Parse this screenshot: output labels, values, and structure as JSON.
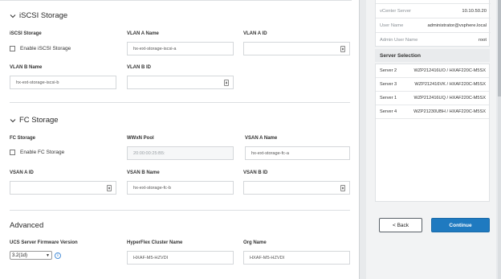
{
  "iscsi": {
    "title": "iSCSI Storage",
    "iscsi_storage_label": "iSCSI Storage",
    "enable_label": "Enable iSCSI Storage",
    "vlan_a_name_label": "VLAN A Name",
    "vlan_a_name_value": "hx-ext-storage-iscsi-a",
    "vlan_a_id_label": "VLAN A ID",
    "vlan_a_id_value": "",
    "vlan_b_name_label": "VLAN B Name",
    "vlan_b_name_value": "hx-ext-storage-iscsi-b",
    "vlan_b_id_label": "VLAN B ID",
    "vlan_b_id_value": ""
  },
  "fc": {
    "title": "FC Storage",
    "fc_storage_label": "FC Storage",
    "enable_label": "Enable FC Storage",
    "wwxn_label": "WWxN Pool",
    "wwxn_value": "20:00:00:25:B5:",
    "vsan_a_name_label": "VSAN A Name",
    "vsan_a_name_value": "hx-ext-storage-fc-a",
    "vsan_a_id_label": "VSAN A ID",
    "vsan_a_id_value": "",
    "vsan_b_name_label": "VSAN B Name",
    "vsan_b_name_value": "hx-ext-storage-fc-b",
    "vsan_b_id_label": "VSAN B ID",
    "vsan_b_id_value": ""
  },
  "advanced": {
    "title": "Advanced",
    "firmware_label": "UCS Server Firmware Version",
    "firmware_value": "3.2(1d)",
    "cluster_name_label": "HyperFlex Cluster Name",
    "cluster_name_value": "HXAF-M5-HZVDI",
    "org_name_label": "Org Name",
    "org_name_value": "HXAF-M5-HZVDI"
  },
  "summary": [
    {
      "key": "vCenter Server",
      "value": "10.10.50.20"
    },
    {
      "key": "User Name",
      "value": "administrator@vsphere.local"
    },
    {
      "key": "Admin User Name",
      "value": "root"
    }
  ],
  "server_selection": {
    "title": "Server Selection",
    "servers": [
      {
        "name": "Server 2",
        "model": "WZP212416UO / HXAF220C-M5SX"
      },
      {
        "name": "Server 3",
        "model": "WZP212416VK / HXAF220C-M5SX"
      },
      {
        "name": "Server 1",
        "model": "WZP212416UQ / HXAF220C-M5SX"
      },
      {
        "name": "Server 4",
        "model": "WZP21230UBH / HXAF220C-M5SX"
      }
    ]
  },
  "buttons": {
    "back": "< Back",
    "continue": "Continue"
  },
  "colors": {
    "accent": "#1f7ac0",
    "info": "#4a90d9"
  }
}
